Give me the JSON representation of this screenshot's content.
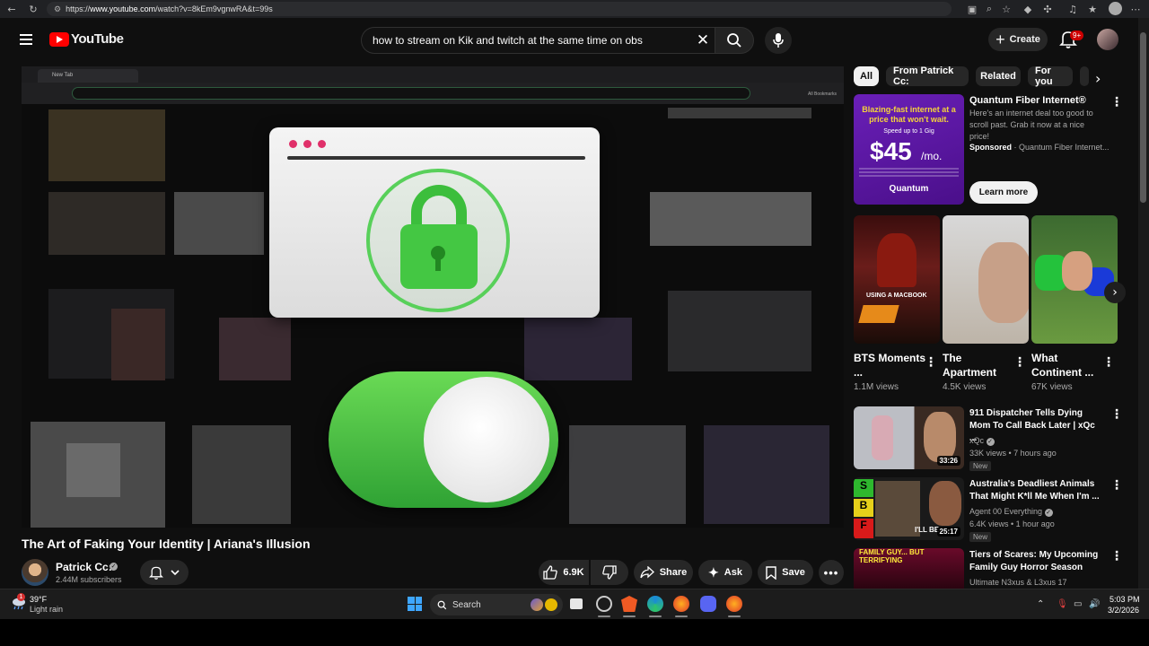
{
  "browser": {
    "url_prefix": "https://",
    "url_host": "www.youtube.com",
    "url_path": "/watch?v=8kEm9vgnwRA&t=99s"
  },
  "header": {
    "logo_text": "YouTube",
    "search_value": "how to stream on Kik and twitch at the same time on obs",
    "create_label": "Create",
    "notification_badge": "9+"
  },
  "video": {
    "inner_tab_label": "New Tab",
    "inner_bookmarks_label": "All Bookmarks",
    "title": "The Art of Faking Your Identity | Ariana's Illusion",
    "channel_name": "Patrick Cc:",
    "subscribers": "2.44M subscribers",
    "likes": "6.9K",
    "share_label": "Share",
    "ask_label": "Ask",
    "save_label": "Save"
  },
  "chips": [
    "All",
    "From Patrick Cc:",
    "Related",
    "For you"
  ],
  "ad": {
    "thumb_headline": "Blazing-fast internet at a price that won't wait.",
    "thumb_sub": "Speed up to 1 Gig",
    "thumb_price": "$45",
    "thumb_per": "/mo.",
    "thumb_brand": "Quantum",
    "title": "Quantum Fiber Internet®",
    "description": "Here's an internet deal too good to scroll past. Grab it now at a nice price!",
    "sponsored_label": "Sponsored",
    "sponsored_by": " · Quantum Fiber Internet...",
    "cta": "Learn more"
  },
  "shorts": [
    {
      "title": "BTS Moments ...",
      "views": "1.1M views",
      "overlay": "USING A MACBOOK"
    },
    {
      "title": "The Apartment",
      "views": "4.5K views"
    },
    {
      "title": "What Continent ...",
      "views": "67K views"
    }
  ],
  "recommendations": [
    {
      "title": "911 Dispatcher Tells Dying Mom To Call Back Later | xQc ...",
      "channel": "xQc",
      "meta": "33K views • 7 hours ago",
      "badge": "New",
      "duration": "33:26"
    },
    {
      "title": "Australia's Deadliest Animals That Might K*ll Me When I'm ...",
      "channel": "Agent 00 Everything",
      "meta": "6.4K views • 1 hour ago",
      "badge": "New",
      "duration": "25:17",
      "overlay": "I'LL BE"
    },
    {
      "title": "Tiers of Scares: My Upcoming Family Guy Horror Season",
      "channel": "Ultimate N3xus & L3xus 17",
      "overlay": "FAMILY GUY... BUT TERRIFYING"
    }
  ],
  "taskbar": {
    "weather_temp": "39°F",
    "weather_desc": "Light rain",
    "weather_badge": "1",
    "search_label": "Search",
    "time": "5:03 PM",
    "date": "3/2/2026"
  },
  "colors": {
    "accent_red": "#ff0000",
    "bg": "#0f0f0f",
    "chip_active": "#f1f1f1",
    "lock_green": "#44c743"
  }
}
